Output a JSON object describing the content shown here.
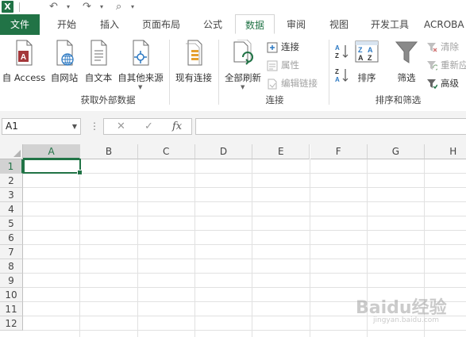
{
  "app": {
    "logo": "X"
  },
  "quick_access": {
    "undo": "↶",
    "redo": "↷",
    "preview": "⌕"
  },
  "tabs": [
    {
      "label": "文件",
      "kind": "file"
    },
    {
      "label": "开始"
    },
    {
      "label": "插入"
    },
    {
      "label": "页面布局"
    },
    {
      "label": "公式"
    },
    {
      "label": "数据",
      "kind": "active"
    },
    {
      "label": "审阅"
    },
    {
      "label": "视图"
    },
    {
      "label": "开发工具"
    },
    {
      "label": "ACROBA"
    }
  ],
  "ribbon": {
    "get_external": {
      "label": "获取外部数据",
      "buttons": [
        {
          "label": "自 Access",
          "icon": "access-db-icon"
        },
        {
          "label": "自网站",
          "icon": "web-page-icon"
        },
        {
          "label": "自文本",
          "icon": "text-file-icon"
        },
        {
          "label": "自其他来源",
          "icon": "other-sources-icon"
        },
        {
          "label": "现有连接",
          "icon": "existing-connections-icon"
        }
      ]
    },
    "connections": {
      "label": "连接",
      "refresh_all": "全部刷新",
      "connect": "连接",
      "properties": "属性",
      "edit_links": "编辑链接"
    },
    "sort_filter": {
      "label": "排序和筛选",
      "sort": "排序",
      "filter": "筛选",
      "clear": "清除",
      "reapply": "重新应",
      "advanced": "高级"
    }
  },
  "formula_bar": {
    "name_box": "A1",
    "cancel": "✕",
    "enter": "✓",
    "fx": "fx",
    "formula": ""
  },
  "grid": {
    "columns": [
      "A",
      "B",
      "C",
      "D",
      "E",
      "F",
      "G",
      "H"
    ],
    "rows": [
      "1",
      "2",
      "3",
      "4",
      "5",
      "6",
      "7",
      "8",
      "9",
      "10",
      "11",
      "12"
    ],
    "active_cell": "A1"
  },
  "colors": {
    "accent": "#217346"
  },
  "watermark": {
    "text": "Baidu经验",
    "sub": "jingyan.baidu.com"
  }
}
